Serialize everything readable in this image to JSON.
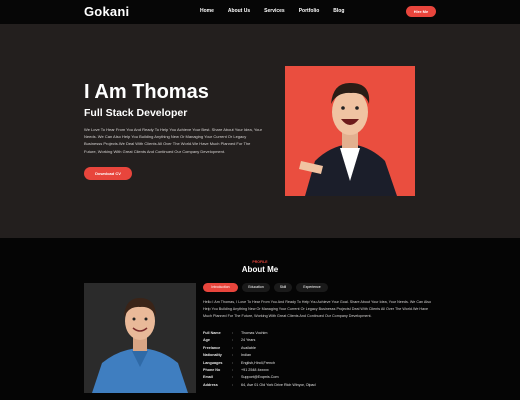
{
  "nav": {
    "logo": "Gokani",
    "items": [
      "Home",
      "About Us",
      "Services",
      "Portfolio",
      "Blog"
    ],
    "hire_label": "Hire Me"
  },
  "hero": {
    "title": "I Am Thomas",
    "subtitle": "Full Stack Developer",
    "description": "We Love To Hear From You And Ready To Help You Achieve Your Best. Share About Your Idea, Your Needs. We Can Also Help You Building Anything New Or Managing Your Current Or Legacy Businesss Projects.We Deal With Clients All Over The World.We Have Much Planned For The Future, Working With Great Clients And Continued Our Company Development.",
    "cv_label": "Download CV"
  },
  "about": {
    "kicker": "PROFILE",
    "title": "About Me",
    "tabs": [
      "Introduction",
      "Education",
      "Skill",
      "Experience"
    ],
    "active_tab": "Introduction",
    "intro": "Hello I Am Thomas, I Love To Hear From You And Ready To Help You Achieve Your Goal. Share About Your Idea, Your Needs. We Can Also Help You Building Anything New Or Managing Your Current Or Legacy Businesss ProjectsI Deal With Clients All Over The World.We Have Much Planned For The Future, Working With Great Clients And Continued Our Company Development.",
    "info": [
      {
        "label": "Full Name",
        "value": "Thomas Vochim"
      },
      {
        "label": "Age",
        "value": "24 Years"
      },
      {
        "label": "Freelance",
        "value": "Available"
      },
      {
        "label": "Nationality",
        "value": "Indian"
      },
      {
        "label": "Languages",
        "value": "English,Hindi,French"
      },
      {
        "label": "Phone No",
        "value": "+91 2548 4xxxxx"
      },
      {
        "label": "Email",
        "value": "Support@Exqmis.Com"
      },
      {
        "label": "Address",
        "value": "64, Ave 01 Old York Drive Rich Winyor, Olpad"
      }
    ]
  },
  "colors": {
    "accent": "#e8453c",
    "hero_bg": "#231f1e",
    "page_bg": "#050505"
  }
}
